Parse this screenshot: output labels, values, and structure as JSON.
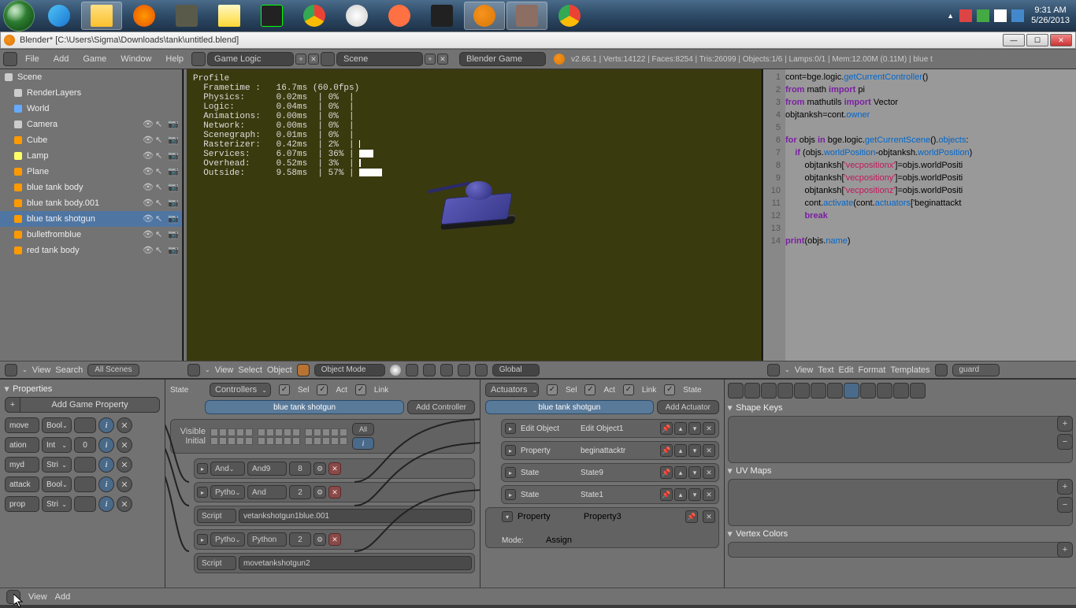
{
  "systray": {
    "time": "9:31 AM",
    "date": "5/26/2013"
  },
  "window_title": "Blender* [C:\\Users\\Sigma\\Downloads\\tank\\untitled.blend]",
  "header": {
    "menus": [
      "File",
      "Add",
      "Game",
      "Window",
      "Help"
    ],
    "layout": "Game Logic",
    "scene": "Scene",
    "engine": "Blender Game",
    "stats": "v2.66.1 | Verts:14122 | Faces:8254 | Tris:26099 | Objects:1/6 | Lamps:0/1 | Mem:12.00M (0.11M) | blue t"
  },
  "outliner": {
    "items": [
      {
        "name": "Scene",
        "indent": 0,
        "icon": "scene"
      },
      {
        "name": "RenderLayers",
        "indent": 1,
        "icon": "layers"
      },
      {
        "name": "World",
        "indent": 1,
        "icon": "world"
      },
      {
        "name": "Camera",
        "indent": 1,
        "icon": "camera",
        "toggles": true
      },
      {
        "name": "Cube",
        "indent": 1,
        "icon": "mesh",
        "toggles": true
      },
      {
        "name": "Lamp",
        "indent": 1,
        "icon": "lamp",
        "toggles": true
      },
      {
        "name": "Plane",
        "indent": 1,
        "icon": "mesh",
        "toggles": true
      },
      {
        "name": "blue tank body",
        "indent": 1,
        "icon": "mesh",
        "toggles": true
      },
      {
        "name": "blue tank body.001",
        "indent": 1,
        "icon": "mesh",
        "toggles": true
      },
      {
        "name": "blue tank shotgun",
        "indent": 1,
        "icon": "mesh",
        "toggles": true,
        "sel": true
      },
      {
        "name": "bulletfromblue",
        "indent": 1,
        "icon": "mesh",
        "toggles": true
      },
      {
        "name": "red tank body",
        "indent": 1,
        "icon": "mesh",
        "toggles": true
      }
    ],
    "footer": {
      "view": "View",
      "search": "Search",
      "filter": "All Scenes"
    }
  },
  "profile": {
    "title": "Profile",
    "rows": [
      {
        "k": "Frametime :",
        "v": "16.7ms (60.0fps)",
        "p": ""
      },
      {
        "k": "Physics:",
        "v": "0.02ms",
        "p": "0%"
      },
      {
        "k": "Logic:",
        "v": "0.04ms",
        "p": "0%"
      },
      {
        "k": "Animations:",
        "v": "0.00ms",
        "p": "0%"
      },
      {
        "k": "Network:",
        "v": "0.00ms",
        "p": "0%"
      },
      {
        "k": "Scenegraph:",
        "v": "0.01ms",
        "p": "0%"
      },
      {
        "k": "Rasterizer:",
        "v": "0.42ms",
        "p": "2%"
      },
      {
        "k": "Services:",
        "v": "6.07ms",
        "p": "36%"
      },
      {
        "k": "Overhead:",
        "v": "0.52ms",
        "p": "3%"
      },
      {
        "k": "Outside:",
        "v": "9.58ms",
        "p": "57%"
      }
    ]
  },
  "viewport_hdr": {
    "menus": [
      "View",
      "Select",
      "Object"
    ],
    "mode": "Object Mode",
    "orientation": "Global"
  },
  "code_lines": [
    {
      "n": 1,
      "raw": "cont=bge.logic.getCurrentController()"
    },
    {
      "n": 2,
      "raw": "from math import pi"
    },
    {
      "n": 3,
      "raw": "from mathutils import Vector"
    },
    {
      "n": 4,
      "raw": "objtanksh=cont.owner"
    },
    {
      "n": 5,
      "raw": ""
    },
    {
      "n": 6,
      "raw": "for objs in bge.logic.getCurrentScene().objects:"
    },
    {
      "n": 7,
      "raw": "    if (objs.worldPosition-objtanksh.worldPosition)"
    },
    {
      "n": 8,
      "raw": "        objtanksh['vecpositionx']=objs.worldPositi"
    },
    {
      "n": 9,
      "raw": "        objtanksh['vecpositiony']=objs.worldPositi"
    },
    {
      "n": 10,
      "raw": "        objtanksh['vecpositionz']=objs.worldPositi"
    },
    {
      "n": 11,
      "raw": "        cont.activate(cont.actuators['beginattackt"
    },
    {
      "n": 12,
      "raw": "        break"
    },
    {
      "n": 13,
      "raw": ""
    },
    {
      "n": 14,
      "raw": "print(objs.name)"
    }
  ],
  "text_hdr": {
    "menus": [
      "View",
      "Text",
      "Edit",
      "Format",
      "Templates"
    ],
    "file": "guard"
  },
  "game_props": {
    "title": "Properties",
    "add_btn": "Add Game Property",
    "rows": [
      {
        "name": "move",
        "type": "Bool",
        "val": ""
      },
      {
        "name": "ation",
        "type": "Int",
        "val": "0"
      },
      {
        "name": "myd",
        "type": "Stri",
        "val": ""
      },
      {
        "name": "attack",
        "type": "Bool",
        "val": ""
      },
      {
        "name": "prop",
        "type": "Stri",
        "val": ""
      }
    ]
  },
  "controllers": {
    "state_label": "State",
    "drop": "Controllers",
    "checks": [
      "Sel",
      "Act",
      "Link"
    ],
    "object": "blue tank shotgun",
    "add": "Add Controller",
    "visible": "Visible",
    "initial": "Initial",
    "all": "All",
    "bricks": [
      {
        "type": "And",
        "name": "And9",
        "num": "8"
      },
      {
        "type": "Pytho",
        "name": "And",
        "num": "2"
      },
      {
        "script_label": "Script",
        "script": "vetankshotgun1blue.001"
      },
      {
        "type": "Pytho",
        "name": "Python",
        "num": "2"
      },
      {
        "script_label": "Script",
        "script": "movetankshotgun2"
      }
    ]
  },
  "actuators": {
    "drop": "Actuators",
    "checks": [
      "Sel",
      "Act",
      "Link",
      "State"
    ],
    "object": "blue tank shotgun",
    "add": "Add Actuator",
    "rows": [
      {
        "type": "Edit Object",
        "name": "Edit Object1"
      },
      {
        "type": "Property",
        "name": "beginattacktr"
      },
      {
        "type": "State",
        "name": "State9"
      },
      {
        "type": "State",
        "name": "State1"
      }
    ],
    "expanded": {
      "type_drop": "Property",
      "name": "Property3",
      "mode_label": "Mode:",
      "mode": "Assign"
    }
  },
  "props_right": {
    "sections": [
      "Shape Keys",
      "UV Maps",
      "Vertex Colors"
    ]
  },
  "bottom_bar": {
    "menus": [
      "View",
      "Add"
    ]
  }
}
